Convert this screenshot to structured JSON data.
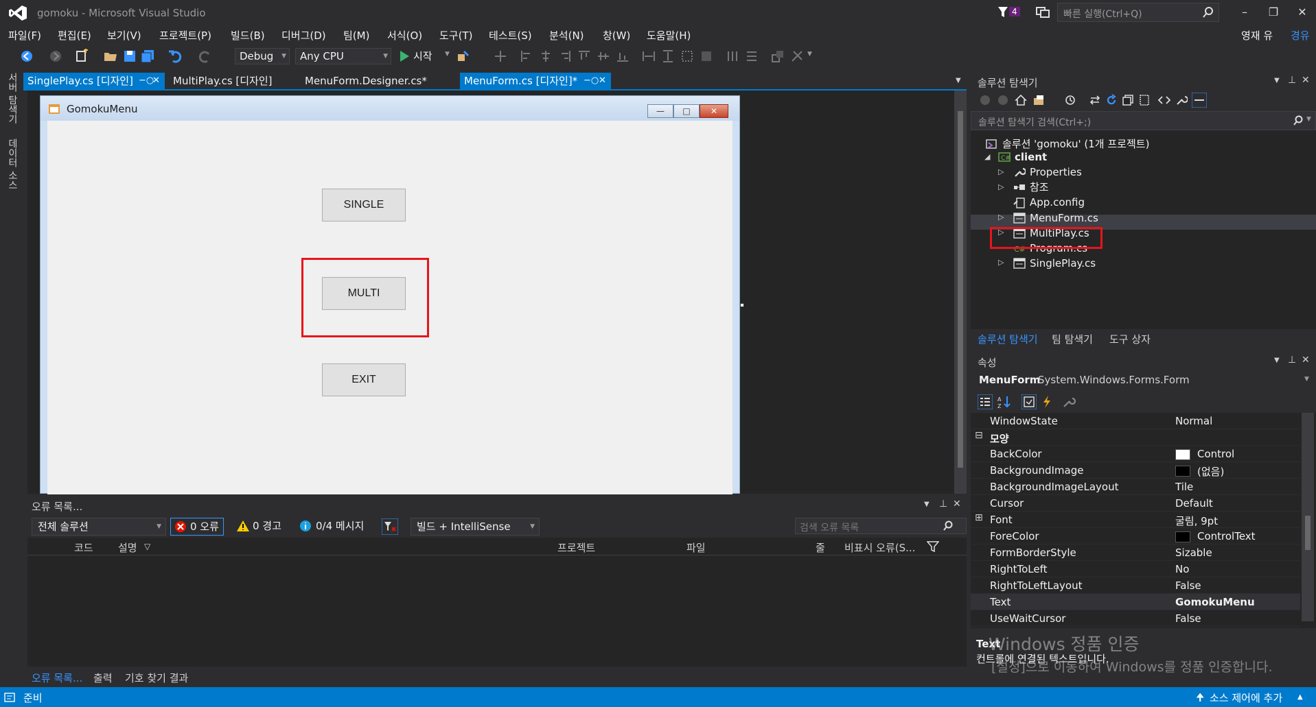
{
  "window": {
    "title": "gomoku - Microsoft Visual Studio",
    "filter_count": "4",
    "quick_launch_placeholder": "빠른 실행(Ctrl+Q)",
    "user_name": "영재 유",
    "user_badge": "경유"
  },
  "menu": {
    "items": [
      "파일(F)",
      "편집(E)",
      "보기(V)",
      "프로젝트(P)",
      "빌드(B)",
      "디버그(D)",
      "팀(M)",
      "서식(O)",
      "도구(T)",
      "테스트(S)",
      "분석(N)",
      "창(W)",
      "도움말(H)"
    ]
  },
  "toolbar": {
    "config": "Debug",
    "platform": "Any CPU",
    "start_label": "시작"
  },
  "side_tabs": [
    "서버 탐색기",
    "데이터 소스"
  ],
  "doc_tabs": [
    {
      "label": "SinglePlay.cs [디자인]"
    },
    {
      "label": "MultiPlay.cs [디자인]"
    },
    {
      "label": "MenuForm.Designer.cs*"
    },
    {
      "label": "MenuForm.cs [디자인]*"
    }
  ],
  "form": {
    "title": "GomokuMenu",
    "buttons": [
      "SINGLE",
      "MULTI",
      "EXIT"
    ]
  },
  "error_list": {
    "title": "오류 목록...",
    "scope": "전체 솔루션",
    "errors": "0 오류",
    "warnings": "0 경고",
    "messages": "0/4 메시지",
    "build_filter": "빌드 + IntelliSense",
    "search_placeholder": "검색 오류 목록",
    "columns": [
      "코드",
      "설명",
      "프로젝트",
      "파일",
      "줄",
      "비표시 오류(S..."
    ],
    "bottom_tabs": [
      "오류 목록...",
      "출력",
      "기호 찾기 결과"
    ]
  },
  "solution_explorer": {
    "title": "솔루션 탐색기",
    "search_placeholder": "솔루션 탐색기 검색(Ctrl+;)",
    "solution": "솔루션 'gomoku' (1개 프로젝트)",
    "project": "client",
    "items": [
      "Properties",
      "참조",
      "App.config",
      "MenuForm.cs",
      "MultiPlay.cs",
      "Program.cs",
      "SinglePlay.cs"
    ],
    "bottom_tabs": [
      "솔루션 탐색기",
      "팀 탐색기",
      "도구 상자"
    ]
  },
  "properties": {
    "title": "속성",
    "object_name": "MenuForm",
    "object_type": "System.Windows.Forms.Form",
    "category": "모양",
    "rows": [
      {
        "name": "WindowState",
        "value": "Normal"
      },
      {
        "name": "BackColor",
        "value": "Control",
        "swatch": "#ffffff"
      },
      {
        "name": "BackgroundImage",
        "value": "(없음)",
        "swatch": "#000000"
      },
      {
        "name": "BackgroundImageLayout",
        "value": "Tile"
      },
      {
        "name": "Cursor",
        "value": "Default"
      },
      {
        "name": "Font",
        "value": "굴림, 9pt"
      },
      {
        "name": "ForeColor",
        "value": "ControlText",
        "swatch": "#000000"
      },
      {
        "name": "FormBorderStyle",
        "value": "Sizable"
      },
      {
        "name": "RightToLeft",
        "value": "No"
      },
      {
        "name": "RightToLeftLayout",
        "value": "False"
      },
      {
        "name": "Text",
        "value": "GomokuMenu"
      },
      {
        "name": "UseWaitCursor",
        "value": "False"
      }
    ],
    "desc_name": "Text",
    "desc_text": "컨트롤에 연결된 텍스트입니다."
  },
  "watermark": {
    "line1": "Windows 정품 인증",
    "line2": "[설정]으로 이동하여 Windows를 정품 인증합니다."
  },
  "status": {
    "left": "준비",
    "right": "소스 제어에 추가"
  },
  "colors": {
    "accent": "#007acc",
    "highlight_box": "#e8141b"
  }
}
